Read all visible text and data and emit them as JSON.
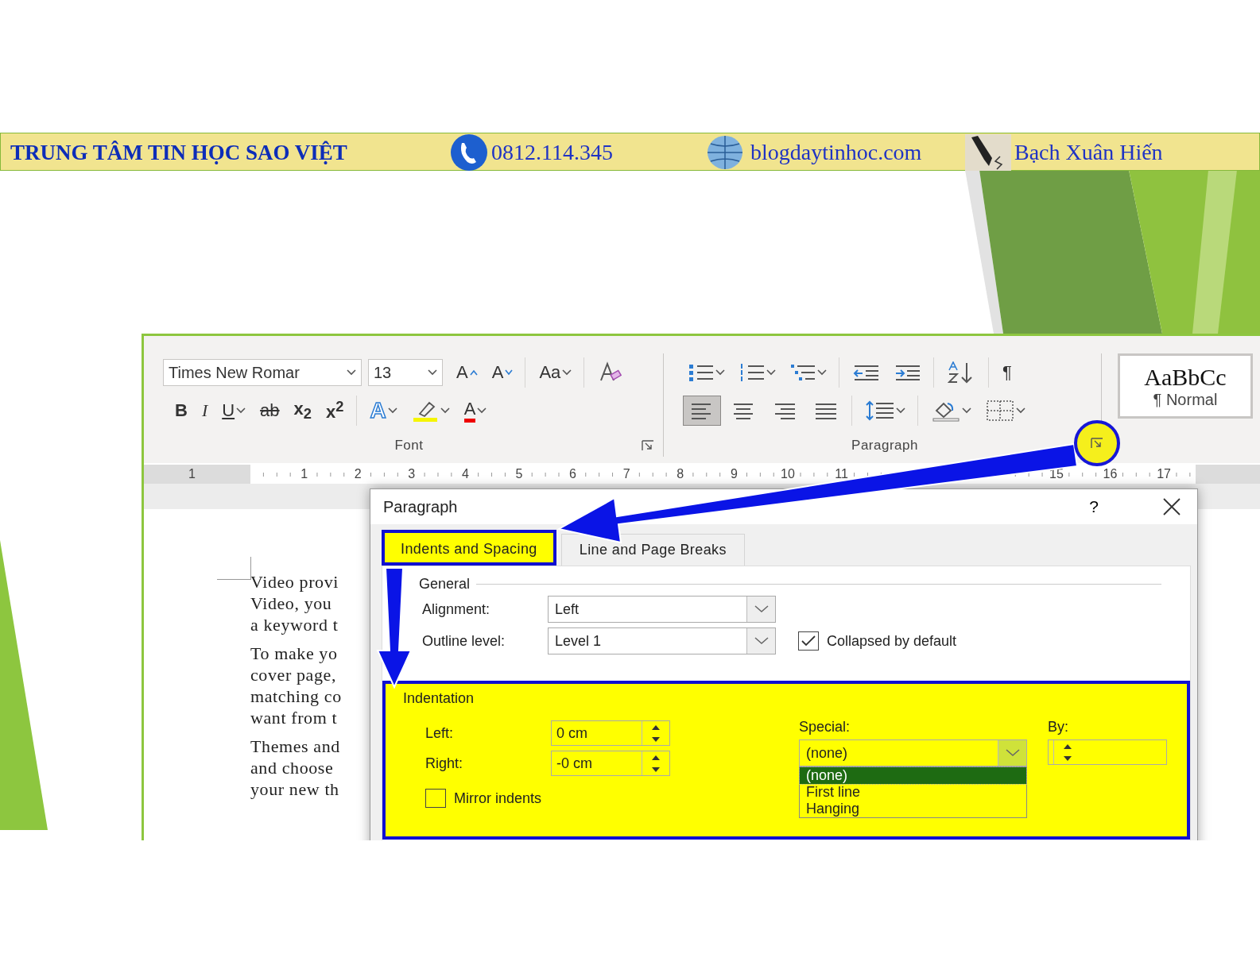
{
  "header": {
    "title": "TRUNG TÂM TIN HỌC SAO VIỆT",
    "phone": "0812.114.345",
    "website": "blogdaytinhoc.com",
    "author": "Bạch Xuân Hiến"
  },
  "ribbon": {
    "font": {
      "label": "Font",
      "font_name": "Times New Romar",
      "font_size": "13",
      "row1": [
        [
          {
            "kind": "grow",
            "label": "A",
            "menu": false
          },
          {
            "kind": "shrink",
            "label": "A",
            "menu": false
          }
        ],
        [
          {
            "kind": "case",
            "label": "Aa",
            "menu": true
          }
        ],
        [
          {
            "kind": "clear",
            "menu": false
          }
        ]
      ],
      "row2": [
        [
          {
            "kind": "bold",
            "label": "B",
            "menu": false
          },
          {
            "kind": "italic",
            "label": "I",
            "menu": false
          },
          {
            "kind": "underline",
            "label": "U",
            "menu": true
          },
          {
            "kind": "strike",
            "label": "ab",
            "menu": false
          },
          {
            "kind": "subscript",
            "label": "x$_{2}$",
            "menu": false
          },
          {
            "kind": "superscript",
            "label": "x$^{2}$",
            "menu": false
          }
        ],
        [
          {
            "kind": "effects",
            "label": "A",
            "menu": true
          },
          {
            "kind": "highlight",
            "menu": true
          },
          {
            "kind": "color",
            "label": "A",
            "menu": true
          }
        ]
      ]
    },
    "paragraph": {
      "label": "Paragraph",
      "launcher_highlighted": true,
      "row1": [
        [
          {
            "kind": "bullets",
            "menu": true
          },
          {
            "kind": "numbering",
            "menu": true
          },
          {
            "kind": "multilevel",
            "menu": true
          }
        ],
        [
          {
            "kind": "outdent",
            "menu": false
          },
          {
            "kind": "indent",
            "menu": false
          }
        ],
        [
          {
            "kind": "sort",
            "menu": false
          }
        ],
        [
          {
            "kind": "marks",
            "label": "¶",
            "menu": false
          }
        ]
      ],
      "row2": [
        [
          {
            "kind": "align_left",
            "selected": true,
            "menu": false
          },
          {
            "kind": "align_center",
            "selected": false,
            "menu": false
          },
          {
            "kind": "align_right",
            "selected": false,
            "menu": false
          },
          {
            "kind": "justify",
            "selected": false,
            "menu": false
          }
        ],
        [
          {
            "kind": "line_spacing",
            "menu": true
          }
        ],
        [
          {
            "kind": "shading",
            "menu": true
          },
          {
            "kind": "borders",
            "menu": true
          }
        ]
      ]
    },
    "styles": [
      {
        "sample": "AaBbCc",
        "name": "¶ Normal",
        "selected": true
      }
    ]
  },
  "ruler": {
    "left_labels": [
      "1"
    ],
    "labels": [
      "1",
      "2",
      "3",
      "4",
      "5",
      "6",
      "7",
      "8",
      "9",
      "10",
      "11"
    ],
    "right_labels": [
      "15",
      "16",
      "17"
    ]
  },
  "document": {
    "paragraphs": [
      {
        "lines": [
          "Video provi",
          "Video, you",
          "a keyword t"
        ]
      },
      {
        "lines": [
          "To make yo",
          "cover page,",
          "matching co",
          "want from t"
        ]
      },
      {
        "lines": [
          "Themes and",
          "and choose",
          "your new th"
        ]
      }
    ]
  },
  "dialog": {
    "title": "Paragraph",
    "help": "?",
    "tabs": [
      {
        "label": "Indents and Spacing",
        "selected": true,
        "highlighted": true
      },
      {
        "label": "Line and Page Breaks",
        "selected": false,
        "highlighted": false
      }
    ],
    "general": {
      "legend": "General",
      "alignment": {
        "label": "Alignment:",
        "value": "Left"
      },
      "outline_level": {
        "label": "Outline level:",
        "value": "Level 1"
      },
      "collapsed": {
        "label": "Collapsed by default",
        "checked": true
      }
    },
    "indentation": {
      "legend": "Indentation",
      "highlighted": true,
      "left": {
        "label": "Left:",
        "value": "0 cm"
      },
      "right": {
        "label": "Right:",
        "value": "-0 cm"
      },
      "mirror": {
        "label": "Mirror indents",
        "checked": false
      },
      "special": {
        "label": "Special:",
        "value": "(none)",
        "expanded": true,
        "options": [
          {
            "label": "(none)",
            "selected": true
          },
          {
            "label": "First line",
            "selected": false
          },
          {
            "label": "Hanging",
            "selected": false
          }
        ]
      },
      "by": {
        "label": "By:"
      }
    }
  }
}
